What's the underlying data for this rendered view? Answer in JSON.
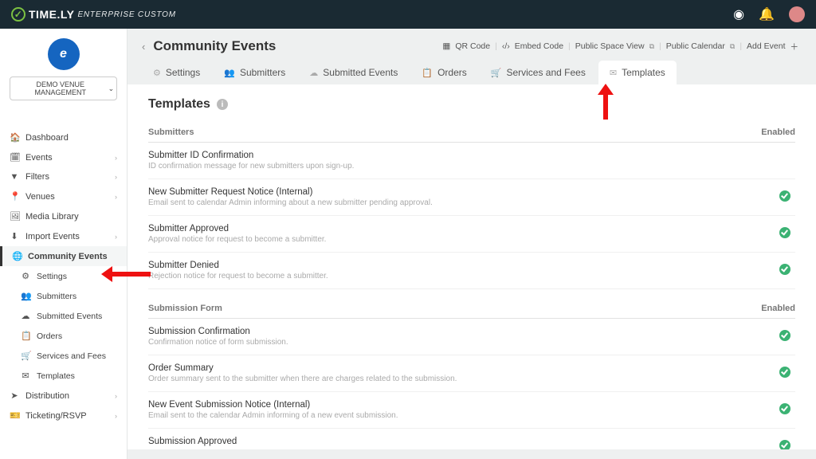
{
  "brand": {
    "name": "TIME.LY",
    "edition": "ENTERPRISE CUSTOM"
  },
  "org": {
    "select_label": "DEMO VENUE MANAGEMENT"
  },
  "sidebar": {
    "items": [
      {
        "label": "Dashboard"
      },
      {
        "label": "Events"
      },
      {
        "label": "Filters"
      },
      {
        "label": "Venues"
      },
      {
        "label": "Media Library"
      },
      {
        "label": "Import Events"
      },
      {
        "label": "Community Events"
      },
      {
        "label": "Distribution"
      },
      {
        "label": "Ticketing/RSVP"
      }
    ],
    "sub": [
      {
        "label": "Settings"
      },
      {
        "label": "Submitters"
      },
      {
        "label": "Submitted Events"
      },
      {
        "label": "Orders"
      },
      {
        "label": "Services and Fees"
      },
      {
        "label": "Templates"
      }
    ]
  },
  "page": {
    "title": "Community Events",
    "actions": {
      "qr": "QR Code",
      "embed": "Embed Code",
      "public_space": "Public Space View",
      "public_cal": "Public Calendar",
      "add": "Add Event"
    }
  },
  "tabs": {
    "settings": "Settings",
    "submitters": "Submitters",
    "submitted": "Submitted Events",
    "orders": "Orders",
    "services": "Services and Fees",
    "templates": "Templates"
  },
  "panel": {
    "title": "Templates",
    "enabled_label": "Enabled",
    "sections": [
      {
        "title": "Submitters",
        "rows": [
          {
            "name": "Submitter ID Confirmation",
            "desc": "ID confirmation message for new submitters upon sign-up.",
            "enabled": false
          },
          {
            "name": "New Submitter Request Notice (Internal)",
            "desc": "Email sent to calendar Admin informing about a new submitter pending approval.",
            "enabled": true
          },
          {
            "name": "Submitter Approved",
            "desc": "Approval notice for request to become a submitter.",
            "enabled": true
          },
          {
            "name": "Submitter Denied",
            "desc": "Rejection notice for request to become a submitter.",
            "enabled": true
          }
        ]
      },
      {
        "title": "Submission Form",
        "rows": [
          {
            "name": "Submission Confirmation",
            "desc": "Confirmation notice of form submission.",
            "enabled": true
          },
          {
            "name": "Order Summary",
            "desc": "Order summary sent to the submitter when there are charges related to the submission.",
            "enabled": true
          },
          {
            "name": "New Event Submission Notice (Internal)",
            "desc": "Email sent to the calendar Admin informing of a new event submission.",
            "enabled": true
          },
          {
            "name": "Submission Approved",
            "desc": "",
            "enabled": true
          }
        ]
      }
    ]
  }
}
